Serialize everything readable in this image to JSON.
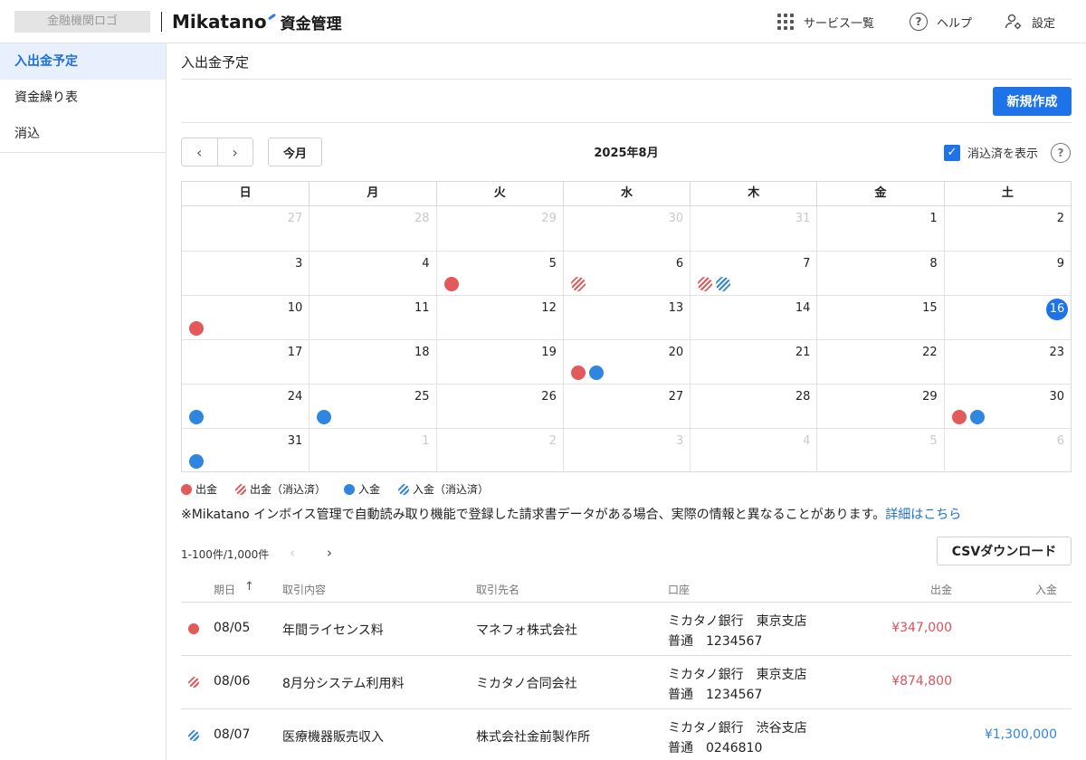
{
  "header": {
    "bank_logo": "金融機関ロゴ",
    "brand": "Mikatano",
    "app_name": "資金管理",
    "nav": [
      {
        "label": "サービス一覧",
        "icon": "grid-icon"
      },
      {
        "label": "ヘルプ",
        "icon": "help-icon"
      },
      {
        "label": "設定",
        "icon": "settings-icon"
      }
    ]
  },
  "sidebar": {
    "items": [
      {
        "label": "入出金予定",
        "active": true
      },
      {
        "label": "資金繰り表",
        "active": false
      },
      {
        "label": "消込",
        "active": false
      }
    ]
  },
  "page": {
    "title": "入出金予定",
    "new_button": "新規作成"
  },
  "toolbar": {
    "prev": "‹",
    "next": "›",
    "today": "今月",
    "month": "2025年8月",
    "show_cleared_label": "消込済を表示",
    "show_cleared": true,
    "help": "?"
  },
  "calendar": {
    "weekdays": [
      "日",
      "月",
      "火",
      "水",
      "木",
      "金",
      "土"
    ],
    "today": 16,
    "weeks": [
      [
        {
          "d": "27",
          "other": true
        },
        {
          "d": "28",
          "other": true
        },
        {
          "d": "29",
          "other": true
        },
        {
          "d": "30",
          "other": true
        },
        {
          "d": "31",
          "other": true
        },
        {
          "d": "1"
        },
        {
          "d": "2"
        }
      ],
      [
        {
          "d": "3"
        },
        {
          "d": "4"
        },
        {
          "d": "5",
          "marks": [
            "out"
          ]
        },
        {
          "d": "6",
          "marks": [
            "out-s"
          ]
        },
        {
          "d": "7",
          "marks": [
            "out-s",
            "in-s"
          ]
        },
        {
          "d": "8"
        },
        {
          "d": "9"
        }
      ],
      [
        {
          "d": "10",
          "marks": [
            "out"
          ]
        },
        {
          "d": "11"
        },
        {
          "d": "12"
        },
        {
          "d": "13"
        },
        {
          "d": "14"
        },
        {
          "d": "15"
        },
        {
          "d": "16",
          "today": true
        }
      ],
      [
        {
          "d": "17"
        },
        {
          "d": "18"
        },
        {
          "d": "19"
        },
        {
          "d": "20",
          "marks": [
            "out",
            "in"
          ]
        },
        {
          "d": "21"
        },
        {
          "d": "22"
        },
        {
          "d": "23"
        }
      ],
      [
        {
          "d": "24",
          "marks": [
            "in"
          ]
        },
        {
          "d": "25",
          "marks": [
            "in"
          ]
        },
        {
          "d": "26"
        },
        {
          "d": "27"
        },
        {
          "d": "28"
        },
        {
          "d": "29"
        },
        {
          "d": "30",
          "marks": [
            "out",
            "in"
          ]
        }
      ],
      [
        {
          "d": "31",
          "marks": [
            "in"
          ]
        },
        {
          "d": "1",
          "other": true
        },
        {
          "d": "2",
          "other": true
        },
        {
          "d": "3",
          "other": true
        },
        {
          "d": "4",
          "other": true
        },
        {
          "d": "5",
          "other": true
        },
        {
          "d": "6",
          "other": true
        }
      ]
    ]
  },
  "legend": [
    {
      "type": "out",
      "label": "出金"
    },
    {
      "type": "out-s",
      "label": "出金（消込済）"
    },
    {
      "type": "in",
      "label": "入金"
    },
    {
      "type": "in-s",
      "label": "入金（消込済）"
    }
  ],
  "note": {
    "text": "※Mikatano インボイス管理で自動読み取り機能で登録した請求書データがある場合、実際の情報と異なることがあります。",
    "link": "詳細はこちら"
  },
  "pagination": {
    "range": "1-100件/1,000件",
    "prev": "‹",
    "next": "›"
  },
  "csv_button": "CSVダウンロード",
  "table": {
    "headers": {
      "date": "期日",
      "sort": "↑",
      "desc": "取引内容",
      "partner": "取引先名",
      "account": "口座",
      "out": "出金",
      "in": "入金"
    },
    "rows": [
      {
        "mark": "out",
        "date": "08/05",
        "desc": "年間ライセンス料",
        "partner": "マネフォ株式会社",
        "bank": "ミカタノ銀行　東京支店",
        "acct": "普通　1234567",
        "out": "¥347,000",
        "in": ""
      },
      {
        "mark": "out-s",
        "date": "08/06",
        "desc": "8月分システム利用料",
        "partner": "ミカタノ合同会社",
        "bank": "ミカタノ銀行　東京支店",
        "acct": "普通　1234567",
        "out": "¥874,800",
        "in": ""
      },
      {
        "mark": "in-s",
        "date": "08/07",
        "desc": "医療機器販売収入",
        "partner": "株式会社金前製作所",
        "bank": "ミカタノ銀行　渋谷支店",
        "acct": "普通　0246810",
        "out": "",
        "in": "¥1,300,000"
      }
    ]
  },
  "colors": {
    "accent": "#1e73e8",
    "outflow": "#e25a5a",
    "inflow": "#2f86de"
  }
}
